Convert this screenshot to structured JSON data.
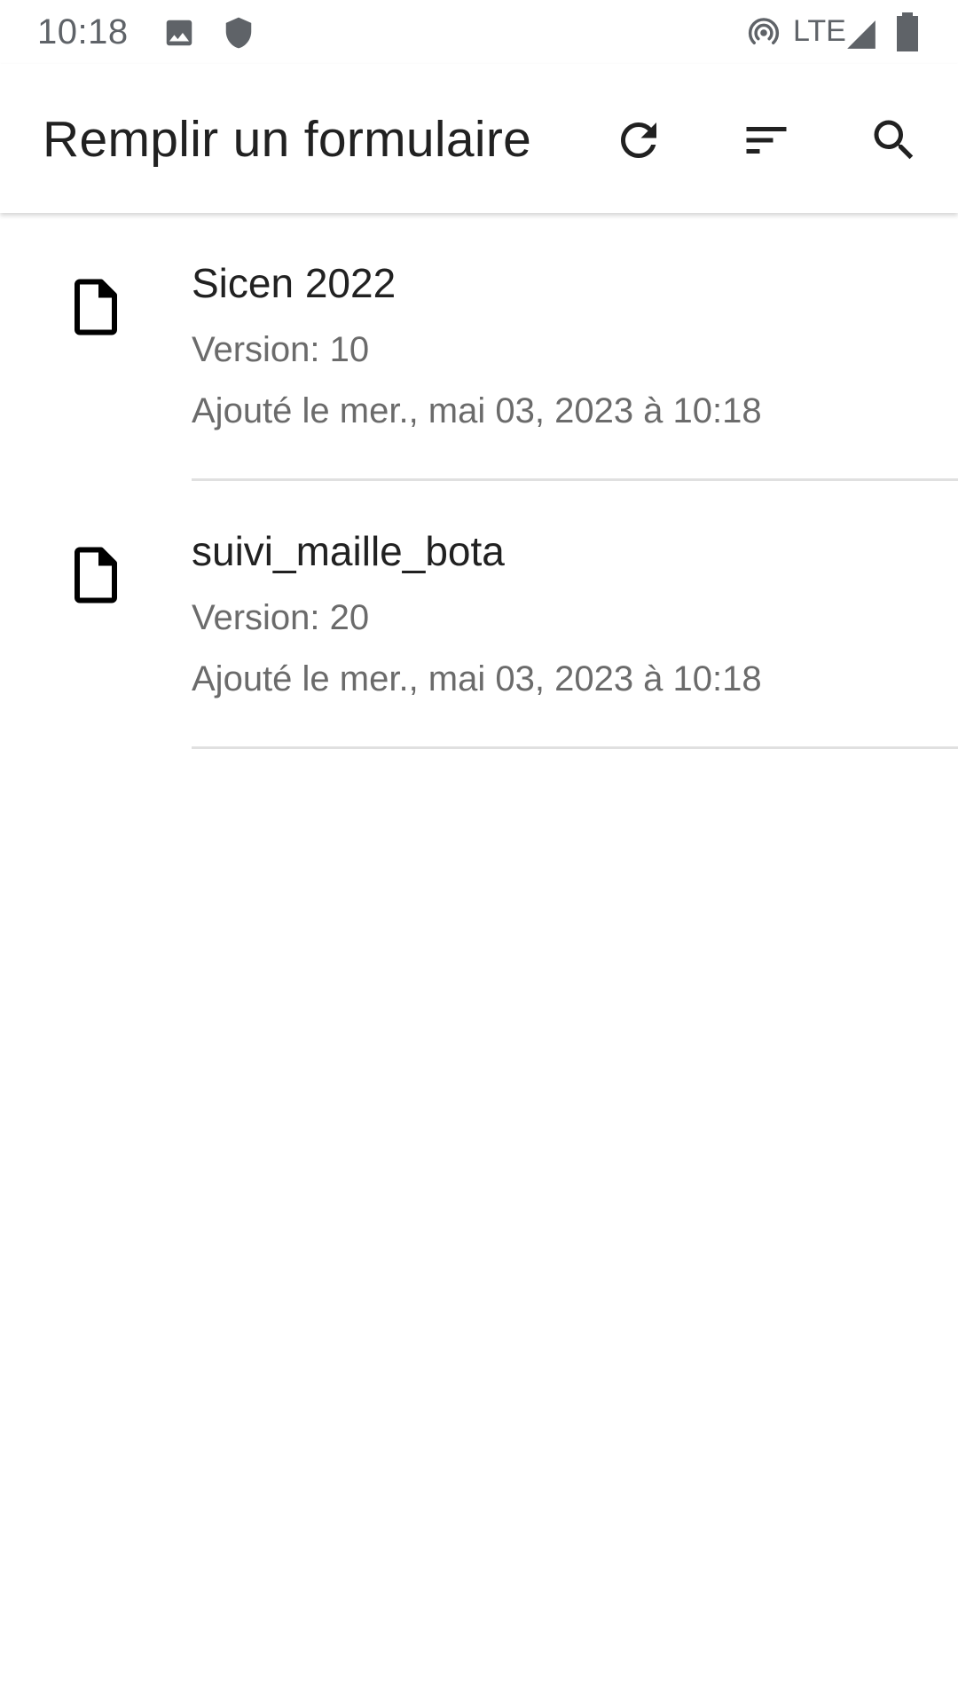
{
  "status_bar": {
    "time": "10:18",
    "network": "LTE",
    "icons": [
      "image-icon",
      "shield-icon",
      "hotspot-icon",
      "signal-icon",
      "battery-icon"
    ]
  },
  "app_bar": {
    "title": "Remplir un formulaire",
    "actions": [
      "refresh-icon",
      "sort-icon",
      "search-icon"
    ]
  },
  "forms": [
    {
      "name": "Sicen 2022",
      "version": "Version: 10",
      "added": "Ajouté le mer., mai 03, 2023 à 10:18",
      "icon": "file-icon"
    },
    {
      "name": "suivi_maille_bota",
      "version": "Version: 20",
      "added": "Ajouté le mer., mai 03, 2023 à 10:18",
      "icon": "file-icon"
    }
  ],
  "colors": {
    "primary_text": "#212121",
    "secondary_text": "#6b6b6b",
    "status_icon": "#5f6368",
    "divider": "#e0e0e0",
    "background": "#ffffff"
  }
}
